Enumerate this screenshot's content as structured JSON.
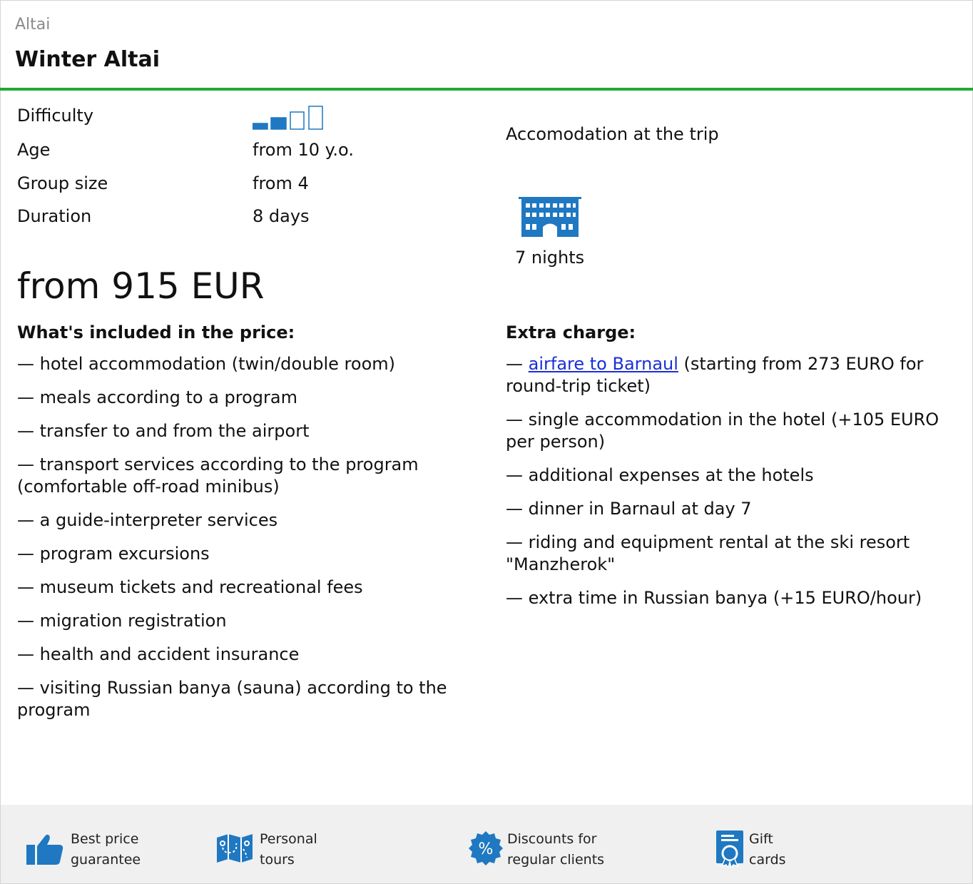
{
  "breadcrumb": "Altai",
  "title": "Winter Altai",
  "specs": {
    "difficulty_label": "Difficulty",
    "difficulty_level": 2,
    "difficulty_max": 4,
    "age_label": "Age",
    "age_value": "from 10 y.o.",
    "group_label": "Group size",
    "group_value": "from 4",
    "duration_label": "Duration",
    "duration_value": "8 days"
  },
  "accommodation": {
    "label": "Accomodation at the trip",
    "icon": "hotel-icon",
    "nights": "7 nights"
  },
  "price": "from 915 EUR",
  "included": {
    "heading": "What's included in the price:",
    "items": [
      "— hotel accommodation (twin/double room)",
      "— meals according to a program",
      "— transfer to and from the airport",
      "— transport services according to the program (comfortable off-road minibus)",
      "— a guide-interpreter services",
      "— program excursions",
      "— museum tickets and recreational fees",
      "— migration registration",
      "— health and accident insurance",
      "— visiting Russian banya (sauna) according to the program"
    ]
  },
  "extra": {
    "heading": "Extra charge:",
    "airfare_prefix": "— ",
    "airfare_link": "airfare to Barnaul",
    "airfare_suffix": " (starting from 273 EURO for round-trip ticket)",
    "items": [
      "— single accommodation in the hotel (+105 EURO per person)",
      "— additional expenses at the hotels",
      "— dinner in Barnaul at day 7",
      "— riding and equipment rental at the ski resort \"Manzherok\"",
      "— extra time in Russian banya (+15 EURO/hour)"
    ]
  },
  "footer": {
    "features": [
      {
        "icon": "thumbs-up-icon",
        "line1": "Best price",
        "line2": "guarantee"
      },
      {
        "icon": "map-icon",
        "line1": "Personal",
        "line2": "tours"
      },
      {
        "icon": "discount-badge-icon",
        "line1": "Discounts for",
        "line2": "regular clients"
      },
      {
        "icon": "gift-card-icon",
        "line1": "Gift",
        "line2": "cards"
      }
    ]
  },
  "colors": {
    "accent_blue": "#1f78c1",
    "green_rule": "#22aa33",
    "link": "#1a2fd8",
    "footer_bg": "#f0f0f0"
  }
}
